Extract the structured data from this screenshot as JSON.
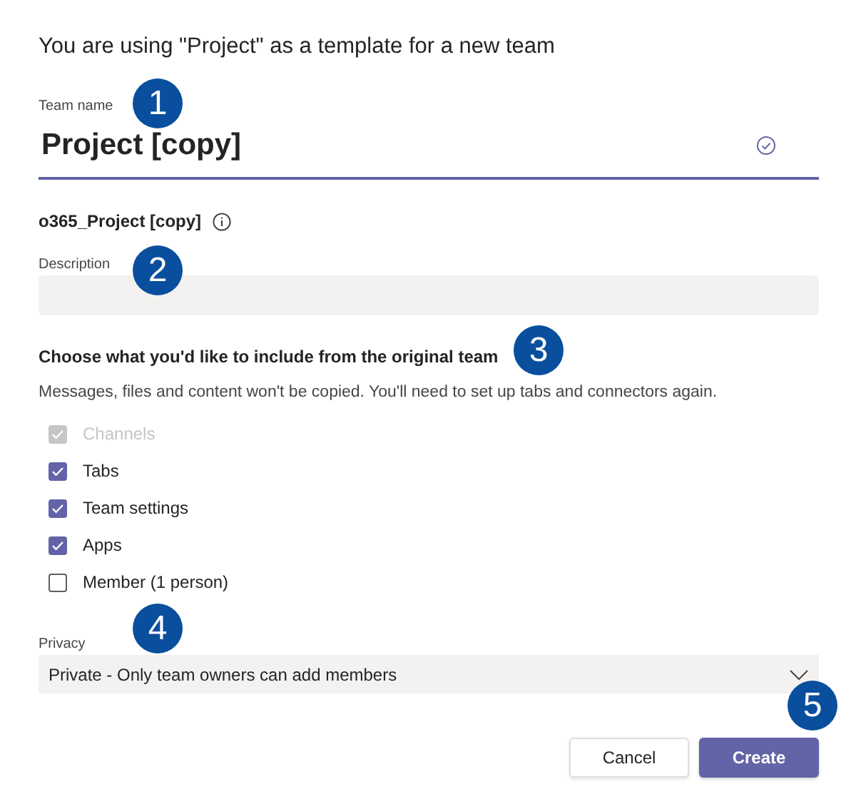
{
  "title": "You are using \"Project\" as a template for a new team",
  "team_name": {
    "label": "Team name",
    "value": "Project [copy]",
    "valid": true
  },
  "alias": {
    "text": "o365_Project [copy]"
  },
  "description": {
    "label": "Description"
  },
  "include": {
    "heading": "Choose what you'd like to include from the original team",
    "note": "Messages, files and content won't be copied. You'll need to set up tabs and connectors again.",
    "options": [
      {
        "label": "Channels",
        "checked": true,
        "disabled": true
      },
      {
        "label": "Tabs",
        "checked": true,
        "disabled": false
      },
      {
        "label": "Team settings",
        "checked": true,
        "disabled": false
      },
      {
        "label": "Apps",
        "checked": true,
        "disabled": false
      },
      {
        "label": "Member (1 person)",
        "checked": false,
        "disabled": false
      }
    ]
  },
  "privacy": {
    "label": "Privacy",
    "value": "Private - Only team owners can add members"
  },
  "buttons": [
    {
      "label": "Cancel",
      "kind": "secondary"
    },
    {
      "label": "Create",
      "kind": "primary"
    }
  ],
  "callouts": [
    {
      "label": "1"
    },
    {
      "label": "2"
    },
    {
      "label": "3"
    },
    {
      "label": "4"
    },
    {
      "label": "5"
    }
  ]
}
